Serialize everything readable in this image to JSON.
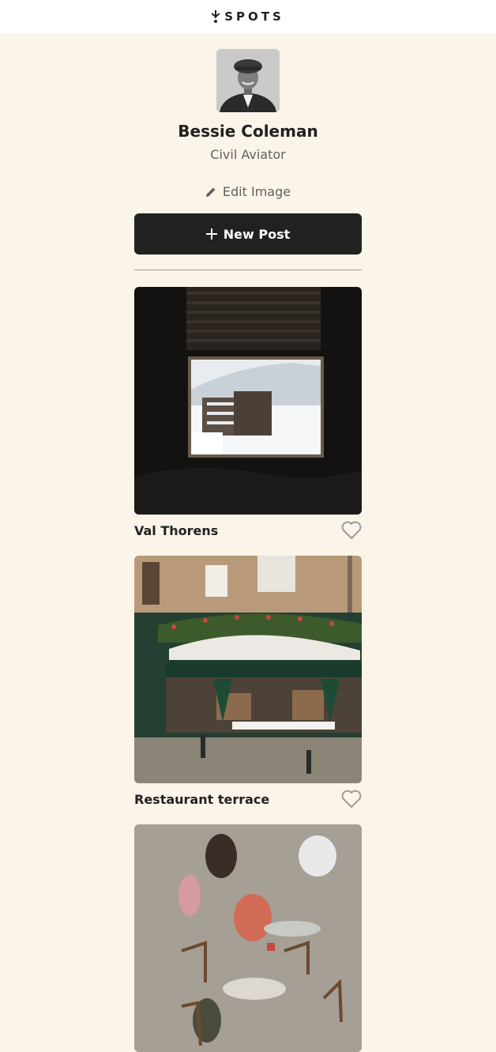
{
  "header": {
    "logo_text": "SPOTS",
    "logo_icon": "spots-logo-icon"
  },
  "profile": {
    "name": "Bessie Coleman",
    "description": "Civil Aviator",
    "avatar_icon": "avatar-portrait",
    "edit_label": "Edit Image",
    "edit_icon": "pencil-icon"
  },
  "actions": {
    "new_post_label": "New Post",
    "new_post_icon": "plus-icon"
  },
  "cards": [
    {
      "title": "Val Thorens",
      "image": "window-snowy-mountain-photo",
      "liked": false
    },
    {
      "title": "Restaurant terrace",
      "image": "restaurant-facade-photo",
      "liked": false
    },
    {
      "title": "",
      "image": "cafe-terrace-crowd-photo",
      "liked": false
    }
  ],
  "colors": {
    "background": "#FBF4E8",
    "text": "#212121",
    "muted": "#616161",
    "button": "#212121",
    "header": "#FFFFFF"
  }
}
